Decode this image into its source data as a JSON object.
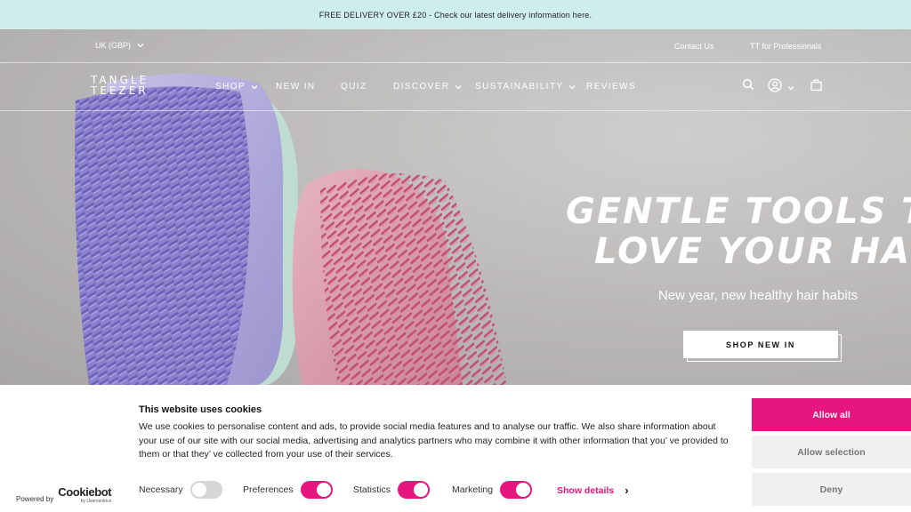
{
  "promo": {
    "text": "FREE DELIVERY OVER £20 - Check our latest delivery information here."
  },
  "utility": {
    "region": "UK (GBP)",
    "contact": "Contact Us",
    "professionals": "TT for Professionals"
  },
  "logo": {
    "line1": "TANGLE",
    "line2": "TEEZER"
  },
  "nav": {
    "items": [
      {
        "label": "SHOP",
        "has_dropdown": true
      },
      {
        "label": "NEW IN",
        "has_dropdown": false
      },
      {
        "label": "QUIZ",
        "has_dropdown": false
      },
      {
        "label": "DISCOVER",
        "has_dropdown": true
      },
      {
        "label": "SUSTAINABILITY",
        "has_dropdown": true
      },
      {
        "label": "REVIEWS",
        "has_dropdown": false
      }
    ],
    "icons": [
      "search-icon",
      "account-icon",
      "chevron-down-icon",
      "bag-icon"
    ]
  },
  "hero": {
    "heading_line1": "GENTLE TOOLS TH",
    "heading_line2": "LOVE YOUR HAI",
    "subheading": "New year, new healthy hair habits",
    "cta": "SHOP NEW IN"
  },
  "cookie_banner": {
    "title": "This website uses cookies",
    "body": "We use cookies to personalise content and ads, to provide social media features and to analyse our traffic. We also share information about your use of our site with our social media, advertising and analytics partners who may combine it with other information that you’ ve provided to them or that they’ ve collected from your use of their services.",
    "powered_by": "Powered by",
    "brand": "Cookiebot",
    "brand_sub": "by Usercentrics",
    "toggles": [
      {
        "label": "Necessary",
        "on": false,
        "disabled": true
      },
      {
        "label": "Preferences",
        "on": true,
        "disabled": false
      },
      {
        "label": "Statistics",
        "on": true,
        "disabled": false
      },
      {
        "label": "Marketing",
        "on": true,
        "disabled": false
      }
    ],
    "show_details": "Show details",
    "buttons": {
      "allow_all": "Allow all",
      "allow_selection": "Allow selection",
      "deny": "Deny"
    }
  },
  "colors": {
    "accent": "#e6157f",
    "promo_bg": "#cdeeed",
    "hero_bg": "#bdbaba"
  }
}
